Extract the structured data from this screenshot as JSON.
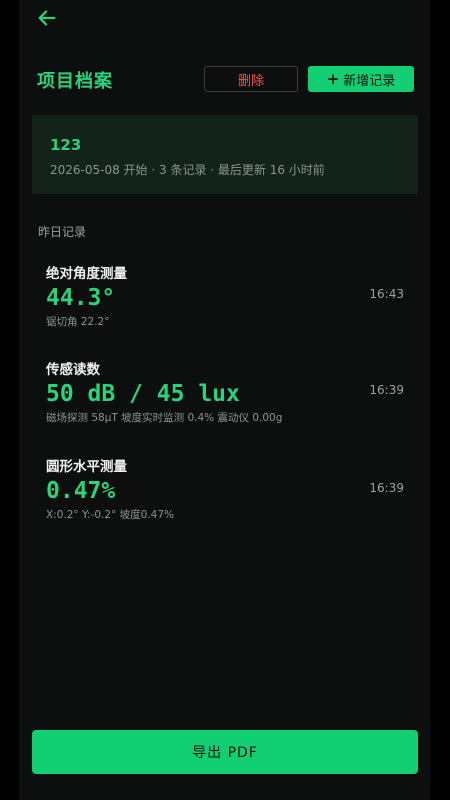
{
  "nav": {
    "back_icon": "arrow-left-icon"
  },
  "header": {
    "title": "项目档案",
    "delete_label": "删除",
    "add_plus": "+",
    "add_label": "新增记录"
  },
  "project": {
    "name": "123",
    "meta": "2026-05-08 开始 · 3 条记录 · 最后更新 16 小时前"
  },
  "section": {
    "label": "昨日记录"
  },
  "records": [
    {
      "title": "绝对角度测量",
      "value": "44.3°",
      "sub": "锯切角 22.2°",
      "time": "16:43"
    },
    {
      "title": "传感读数",
      "value": "50 dB / 45 lux",
      "sub": "磁场探测 58μT  坡度实时监测 0.4%  震动仪 0.00g",
      "time": "16:39"
    },
    {
      "title": "圆形水平测量",
      "value": "0.47%",
      "sub": "X:0.2°  Y:-0.2°  坡度0.47%",
      "time": "16:39"
    }
  ],
  "footer": {
    "export_label": "导出 PDF"
  },
  "colors": {
    "accent": "#13cf73",
    "accent_text": "#2bd37a",
    "danger": "#ff4d4f",
    "background": "#0c0f0d",
    "card": "#132319"
  }
}
